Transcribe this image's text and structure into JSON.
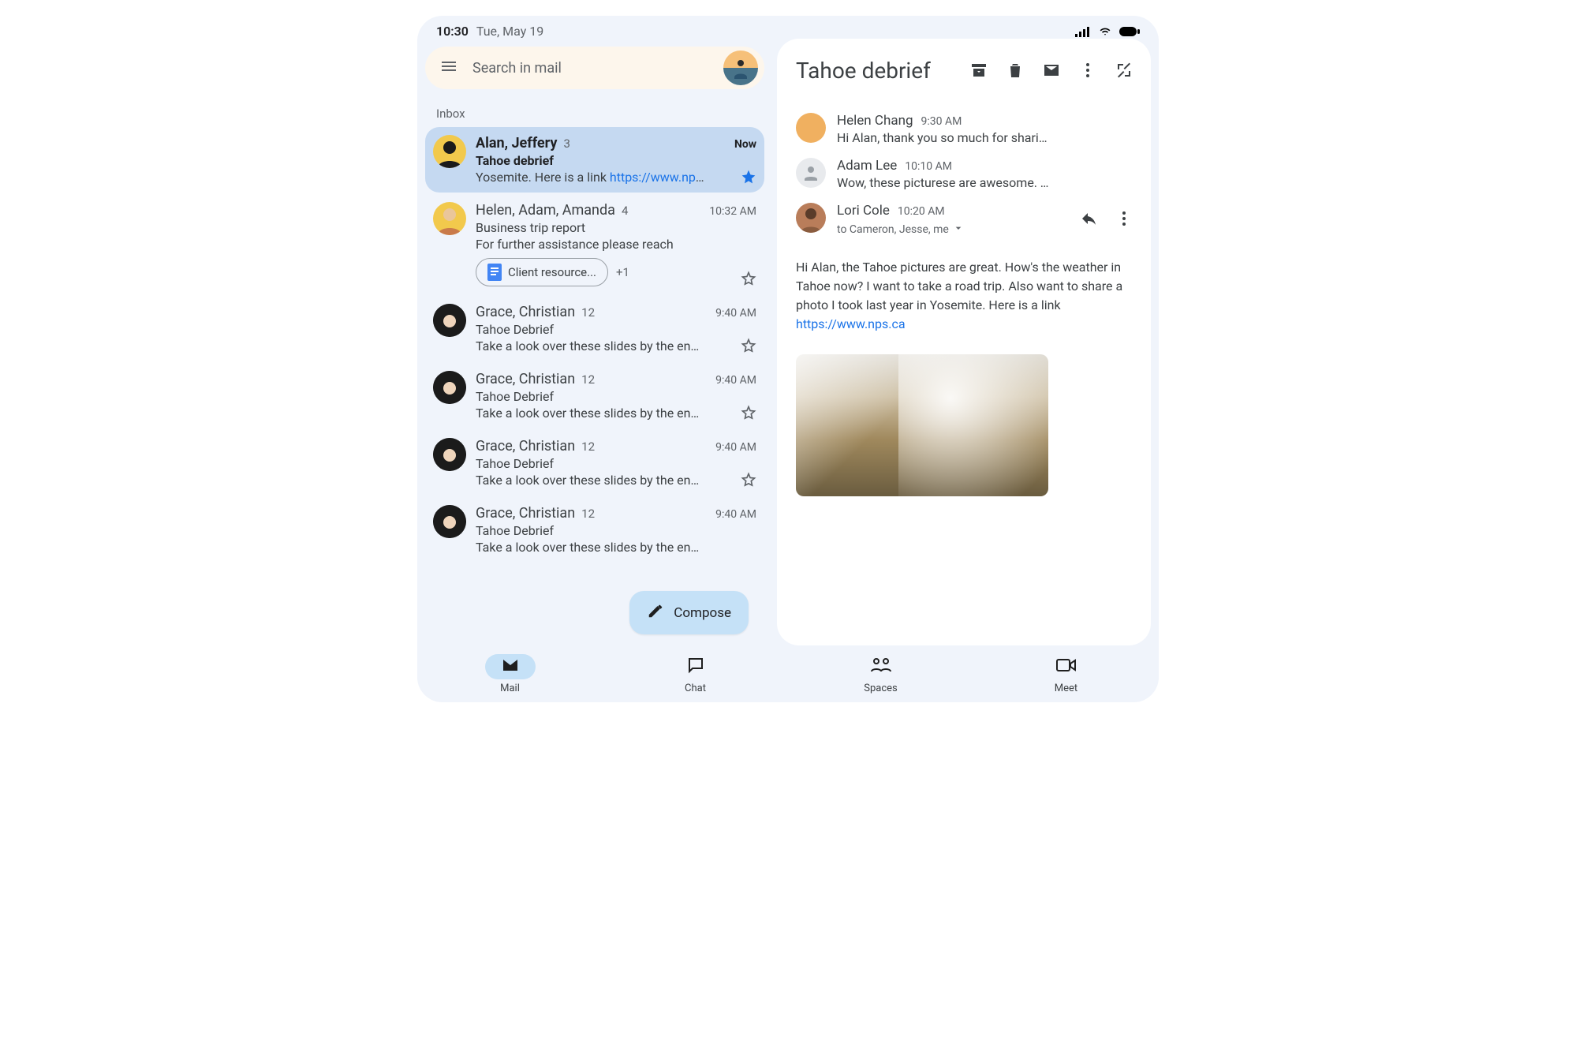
{
  "statusbar": {
    "time": "10:30",
    "date": "Tue, May 19"
  },
  "search": {
    "placeholder": "Search in mail"
  },
  "inbox_label": "Inbox",
  "threads": [
    {
      "senders": "Alan, Jeffery",
      "count": "3",
      "time": "Now",
      "subject": "Tahoe debrief",
      "snippet_text": "Yosemite. Here is a link ",
      "snippet_link": "https://www.nps...",
      "selected": true,
      "starred": true
    },
    {
      "senders": "Helen, Adam, Amanda",
      "count": "4",
      "time": "10:32 AM",
      "subject": "Business trip report",
      "snippet_text": "For further assistance please reach",
      "chip": "Client resource...",
      "chip_more": "+1"
    },
    {
      "senders": "Grace, Christian",
      "count": "12",
      "time": "9:40 AM",
      "subject": "Tahoe Debrief",
      "snippet_text": "Take a look over these slides by the end..."
    },
    {
      "senders": "Grace, Christian",
      "count": "12",
      "time": "9:40 AM",
      "subject": "Tahoe Debrief",
      "snippet_text": "Take a look over these slides by the end..."
    },
    {
      "senders": "Grace, Christian",
      "count": "12",
      "time": "9:40 AM",
      "subject": "Tahoe Debrief",
      "snippet_text": "Take a look over these slides by the end..."
    },
    {
      "senders": "Grace, Christian",
      "count": "12",
      "time": "9:40 AM",
      "subject": "Tahoe Debrief",
      "snippet_text": "Take a look over these slides by the end..."
    }
  ],
  "compose_label": "Compose",
  "conversation": {
    "title": "Tahoe debrief",
    "messages": [
      {
        "name": "Helen Chang",
        "time": "9:30 AM",
        "preview": "Hi Alan, thank you so much for sharin..."
      },
      {
        "name": "Adam Lee",
        "time": "10:10 AM",
        "preview": "Wow, these picturese are awesome. T..."
      },
      {
        "name": "Lori Cole",
        "time": "10:20 AM",
        "recipients": "to Cameron, Jesse, me"
      }
    ],
    "body_text": "Hi Alan, the Tahoe pictures are great. How's the weather in Tahoe now? I want to take a road trip. Also want to share a photo I took last year in Yosemite. Here is a link ",
    "body_link": "https://www.nps.ca"
  },
  "nav": {
    "mail": "Mail",
    "chat": "Chat",
    "spaces": "Spaces",
    "meet": "Meet"
  }
}
